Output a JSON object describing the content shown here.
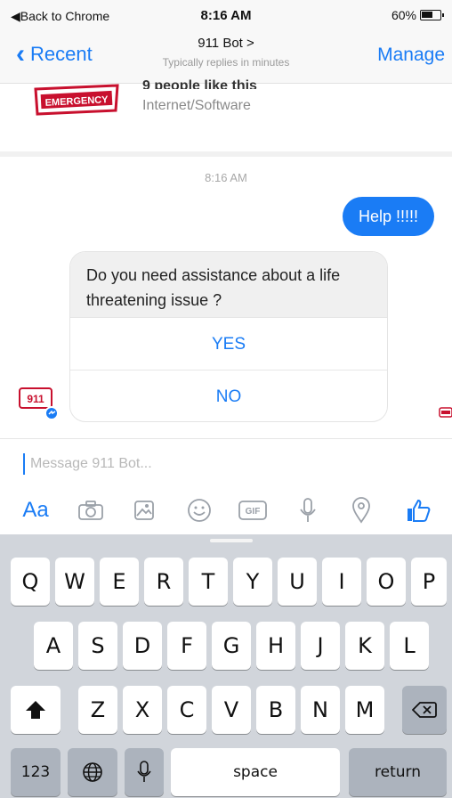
{
  "status_bar": {
    "back_text": "◀Back to Chrome",
    "time": "8:16 AM",
    "battery": "60%"
  },
  "nav": {
    "back_label": "Recent",
    "title": "911 Bot >",
    "subtitle": "Typically replies in minutes",
    "manage_label": "Manage"
  },
  "page_info": {
    "likes": "9 people like this",
    "category": "Internet/Software"
  },
  "chat": {
    "timestamp": "8:16 AM",
    "outgoing_message": "Help !!!!!",
    "card_question": "Do you need assistance about a life threatening issue ?",
    "card_buttons": [
      "YES",
      "NO"
    ]
  },
  "composer": {
    "placeholder": "Message 911 Bot...",
    "tools": [
      "Aa",
      "camera-icon",
      "gallery-icon",
      "emoji-icon",
      "gif-icon",
      "microphone-icon",
      "location-icon",
      "like-icon"
    ],
    "aa_label": "Aa",
    "gif_label": "GIF"
  },
  "keyboard": {
    "row1": [
      "Q",
      "W",
      "E",
      "R",
      "T",
      "Y",
      "U",
      "I",
      "O",
      "P"
    ],
    "row2": [
      "A",
      "S",
      "D",
      "F",
      "G",
      "H",
      "J",
      "K",
      "L"
    ],
    "row3": [
      "Z",
      "X",
      "C",
      "V",
      "B",
      "N",
      "M"
    ],
    "row4": {
      "numbers": "123",
      "space": "space",
      "return": "return"
    }
  },
  "colors": {
    "accent": "#1a7cf5",
    "keyboard_bg": "#d1d5db",
    "brand_red": "#c8102e"
  }
}
